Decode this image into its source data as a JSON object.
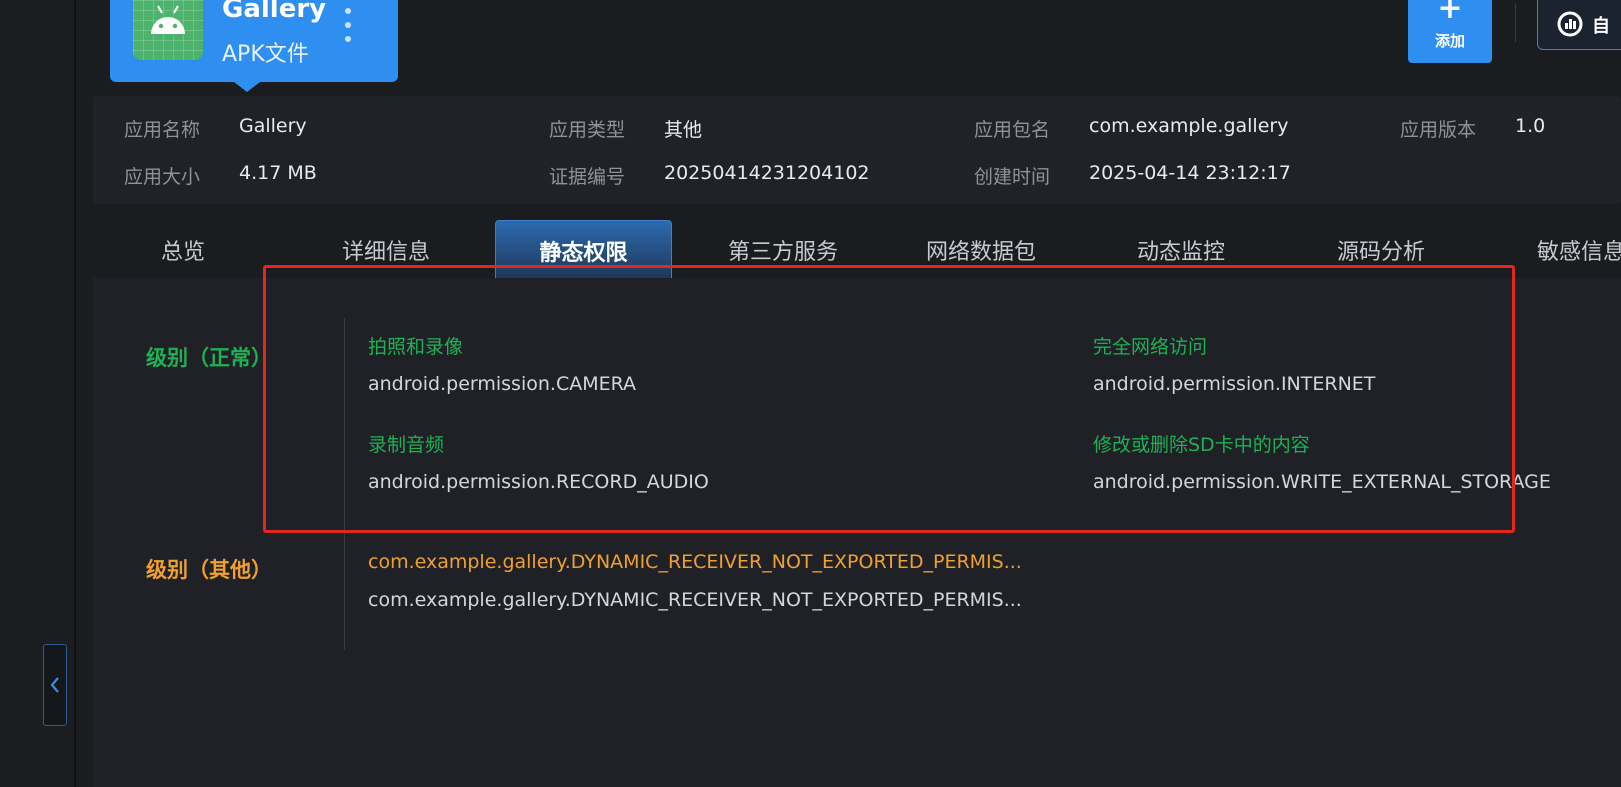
{
  "app": {
    "name": "Gallery",
    "type": "APK文件"
  },
  "toolbar": {
    "add_icon": "+",
    "add_label": "添加",
    "auto_label": "自"
  },
  "info": [
    {
      "key": "应用名称",
      "value": "Gallery"
    },
    {
      "key": "应用类型",
      "value": "其他"
    },
    {
      "key": "应用包名",
      "value": "com.example.gallery"
    },
    {
      "key": "应用版本",
      "value": "1.0"
    },
    {
      "key": "应用大小",
      "value": "4.17 MB"
    },
    {
      "key": "证据编号",
      "value": "20250414231204102"
    },
    {
      "key": "创建时间",
      "value": "2025-04-14 23:12:17"
    }
  ],
  "tabs": [
    {
      "label": "总览"
    },
    {
      "label": "详细信息"
    },
    {
      "label": "静态权限",
      "active": true
    },
    {
      "label": "第三方服务"
    },
    {
      "label": "网络数据包"
    },
    {
      "label": "动态监控"
    },
    {
      "label": "源码分析"
    },
    {
      "label": "敏感信息"
    }
  ],
  "levels": {
    "normal": {
      "label": "级别（正常）",
      "permissions": [
        {
          "title": "拍照和录像",
          "value": "android.permission.CAMERA"
        },
        {
          "title": "完全网络访问",
          "value": "android.permission.INTERNET"
        },
        {
          "title": "录制音频",
          "value": "android.permission.RECORD_AUDIO"
        },
        {
          "title": "修改或删除SD卡中的内容",
          "value": "android.permission.WRITE_EXTERNAL_STORAGE"
        }
      ]
    },
    "other": {
      "label": "级别（其他）",
      "permissions": [
        {
          "title": "com.example.gallery.DYNAMIC_RECEIVER_NOT_EXPORTED_PERMIS...",
          "value": "com.example.gallery.DYNAMIC_RECEIVER_NOT_EXPORTED_PERMIS..."
        }
      ]
    }
  },
  "colors": {
    "accent": "#2f8ff1",
    "normal": "#1db154",
    "other": "#f0a02f",
    "highlight": "#e3261e"
  }
}
